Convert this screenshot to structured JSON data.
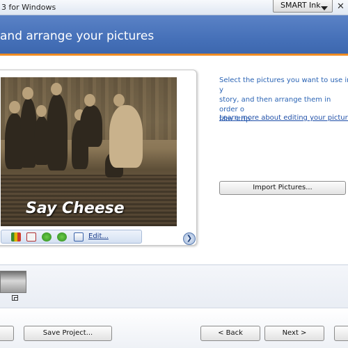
{
  "window": {
    "title": "3 for Windows"
  },
  "smart_ink": {
    "label": "SMART Ink"
  },
  "header": {
    "heading": "and arrange your pictures"
  },
  "preview": {
    "caption": "Say Cheese",
    "edit_label": "Edit..."
  },
  "instructions": {
    "text": "Select the pictures you want to use in y\nstory, and then arrange them in order o\nfilm strip.",
    "learn_more": "Learn more about editing your pictures"
  },
  "buttons": {
    "import": "Import Pictures...",
    "save_project": "Save Project...",
    "back": "< Back",
    "next": "Next >"
  },
  "colors": {
    "header_blue": "#4570b8",
    "accent_orange": "#f08c22",
    "link_blue": "#1f4fa8"
  },
  "icons": [
    "levels-icon",
    "red-eye-icon",
    "rotate-left-icon",
    "rotate-right-icon",
    "edit-icon",
    "next-arrow-icon",
    "duplicate-icon",
    "close-icon",
    "dropdown-caret-icon"
  ]
}
